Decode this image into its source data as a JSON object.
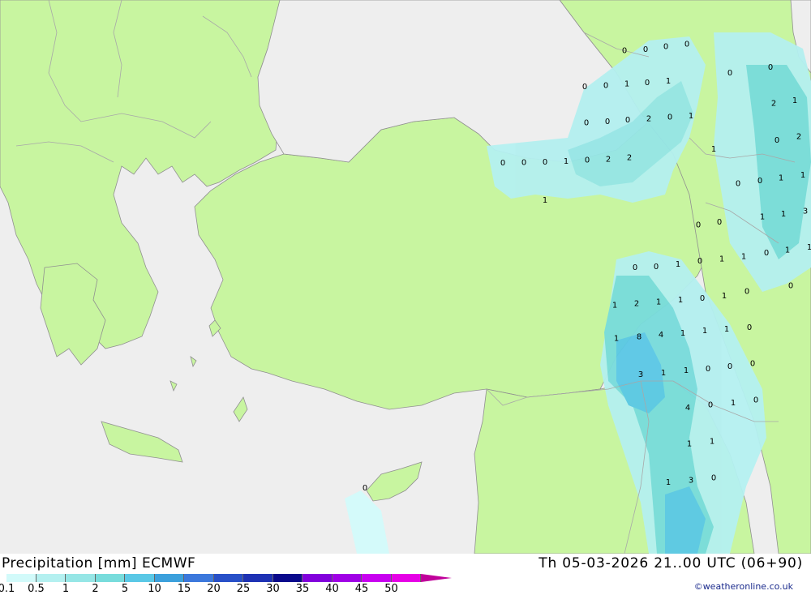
{
  "map": {
    "colors": {
      "sea": "#eeeeee",
      "land": "#c8f5a0",
      "border": "#a8a8a8",
      "coast": "#909090"
    },
    "value_labels": [
      {
        "v": "0",
        "lon": 0.77,
        "lat": 0.09
      },
      {
        "v": "0",
        "lon": 0.796,
        "lat": 0.088
      },
      {
        "v": "0",
        "lon": 0.821,
        "lat": 0.083
      },
      {
        "v": "0",
        "lon": 0.847,
        "lat": 0.078
      },
      {
        "v": "0",
        "lon": 0.9,
        "lat": 0.13
      },
      {
        "v": "0",
        "lon": 0.95,
        "lat": 0.12
      },
      {
        "v": "0",
        "lon": 0.721,
        "lat": 0.155
      },
      {
        "v": "0",
        "lon": 0.747,
        "lat": 0.153
      },
      {
        "v": "1",
        "lon": 0.773,
        "lat": 0.15
      },
      {
        "v": "0",
        "lon": 0.798,
        "lat": 0.148
      },
      {
        "v": "1",
        "lon": 0.824,
        "lat": 0.145
      },
      {
        "v": "2",
        "lon": 0.954,
        "lat": 0.185
      },
      {
        "v": "1",
        "lon": 0.98,
        "lat": 0.18
      },
      {
        "v": "0",
        "lon": 0.723,
        "lat": 0.22
      },
      {
        "v": "0",
        "lon": 0.749,
        "lat": 0.218
      },
      {
        "v": "0",
        "lon": 0.774,
        "lat": 0.215
      },
      {
        "v": "2",
        "lon": 0.8,
        "lat": 0.213
      },
      {
        "v": "0",
        "lon": 0.826,
        "lat": 0.21
      },
      {
        "v": "1",
        "lon": 0.852,
        "lat": 0.208
      },
      {
        "v": "0",
        "lon": 0.958,
        "lat": 0.252
      },
      {
        "v": "2",
        "lon": 0.985,
        "lat": 0.245
      },
      {
        "v": "1",
        "lon": 0.88,
        "lat": 0.268
      },
      {
        "v": "0",
        "lon": 0.62,
        "lat": 0.293
      },
      {
        "v": "0",
        "lon": 0.646,
        "lat": 0.292
      },
      {
        "v": "0",
        "lon": 0.672,
        "lat": 0.291
      },
      {
        "v": "1",
        "lon": 0.698,
        "lat": 0.29
      },
      {
        "v": "0",
        "lon": 0.724,
        "lat": 0.288
      },
      {
        "v": "2",
        "lon": 0.75,
        "lat": 0.286
      },
      {
        "v": "2",
        "lon": 0.776,
        "lat": 0.283
      },
      {
        "v": "0",
        "lon": 0.91,
        "lat": 0.33
      },
      {
        "v": "0",
        "lon": 0.937,
        "lat": 0.325
      },
      {
        "v": "1",
        "lon": 0.963,
        "lat": 0.32
      },
      {
        "v": "1",
        "lon": 0.99,
        "lat": 0.315
      },
      {
        "v": "1",
        "lon": 0.672,
        "lat": 0.36
      },
      {
        "v": "1",
        "lon": 0.94,
        "lat": 0.39
      },
      {
        "v": "1",
        "lon": 0.966,
        "lat": 0.385
      },
      {
        "v": "3",
        "lon": 0.993,
        "lat": 0.38
      },
      {
        "v": "0",
        "lon": 0.861,
        "lat": 0.405
      },
      {
        "v": "0",
        "lon": 0.887,
        "lat": 0.4
      },
      {
        "v": "0",
        "lon": 0.945,
        "lat": 0.455
      },
      {
        "v": "1",
        "lon": 0.971,
        "lat": 0.45
      },
      {
        "v": "1",
        "lon": 0.998,
        "lat": 0.445
      },
      {
        "v": "0",
        "lon": 0.783,
        "lat": 0.482
      },
      {
        "v": "0",
        "lon": 0.809,
        "lat": 0.48
      },
      {
        "v": "1",
        "lon": 0.836,
        "lat": 0.476
      },
      {
        "v": "0",
        "lon": 0.863,
        "lat": 0.47
      },
      {
        "v": "1",
        "lon": 0.89,
        "lat": 0.466
      },
      {
        "v": "1",
        "lon": 0.917,
        "lat": 0.462
      },
      {
        "v": "0",
        "lon": 0.975,
        "lat": 0.515
      },
      {
        "v": "0",
        "lon": 0.921,
        "lat": 0.525
      },
      {
        "v": "1",
        "lon": 0.758,
        "lat": 0.55
      },
      {
        "v": "2",
        "lon": 0.785,
        "lat": 0.547
      },
      {
        "v": "1",
        "lon": 0.812,
        "lat": 0.544
      },
      {
        "v": "1",
        "lon": 0.839,
        "lat": 0.54
      },
      {
        "v": "0",
        "lon": 0.866,
        "lat": 0.537
      },
      {
        "v": "1",
        "lon": 0.893,
        "lat": 0.533
      },
      {
        "v": "0",
        "lon": 0.924,
        "lat": 0.59
      },
      {
        "v": "1",
        "lon": 0.76,
        "lat": 0.61
      },
      {
        "v": "8",
        "lon": 0.788,
        "lat": 0.607
      },
      {
        "v": "4",
        "lon": 0.815,
        "lat": 0.603
      },
      {
        "v": "1",
        "lon": 0.842,
        "lat": 0.6
      },
      {
        "v": "1",
        "lon": 0.869,
        "lat": 0.596
      },
      {
        "v": "1",
        "lon": 0.896,
        "lat": 0.593
      },
      {
        "v": "0",
        "lon": 0.873,
        "lat": 0.665
      },
      {
        "v": "0",
        "lon": 0.9,
        "lat": 0.66
      },
      {
        "v": "0",
        "lon": 0.928,
        "lat": 0.655
      },
      {
        "v": "3",
        "lon": 0.79,
        "lat": 0.675
      },
      {
        "v": "1",
        "lon": 0.818,
        "lat": 0.672
      },
      {
        "v": "1",
        "lon": 0.846,
        "lat": 0.668
      },
      {
        "v": "4",
        "lon": 0.848,
        "lat": 0.735
      },
      {
        "v": "0",
        "lon": 0.876,
        "lat": 0.73
      },
      {
        "v": "1",
        "lon": 0.904,
        "lat": 0.726
      },
      {
        "v": "0",
        "lon": 0.932,
        "lat": 0.721
      },
      {
        "v": "1",
        "lon": 0.85,
        "lat": 0.8
      },
      {
        "v": "1",
        "lon": 0.878,
        "lat": 0.796
      },
      {
        "v": "1",
        "lon": 0.824,
        "lat": 0.87
      },
      {
        "v": "3",
        "lon": 0.852,
        "lat": 0.866
      },
      {
        "v": "0",
        "lon": 0.88,
        "lat": 0.862
      },
      {
        "v": "0",
        "lon": 0.45,
        "lat": 0.88
      }
    ]
  },
  "footer": {
    "title": "Precipitation [mm] ECMWF",
    "datetime": "Th 05-03-2026 21..00 UTC (06+90)",
    "credit": "©weatheronline.co.uk",
    "scale_colors": [
      "#d2fafa",
      "#b4f0f0",
      "#96e6e6",
      "#78dcdc",
      "#5ac8e6",
      "#3ca0dc",
      "#3c78dc",
      "#2850c8",
      "#1e32b4",
      "#0a0a8c",
      "#8200dc",
      "#a000e6",
      "#c800f0",
      "#e600e6",
      "#c0009a"
    ],
    "scale_labels": [
      "0.1",
      "0.5",
      "1",
      "2",
      "5",
      "10",
      "15",
      "20",
      "25",
      "30",
      "35",
      "40",
      "45",
      "50"
    ]
  }
}
